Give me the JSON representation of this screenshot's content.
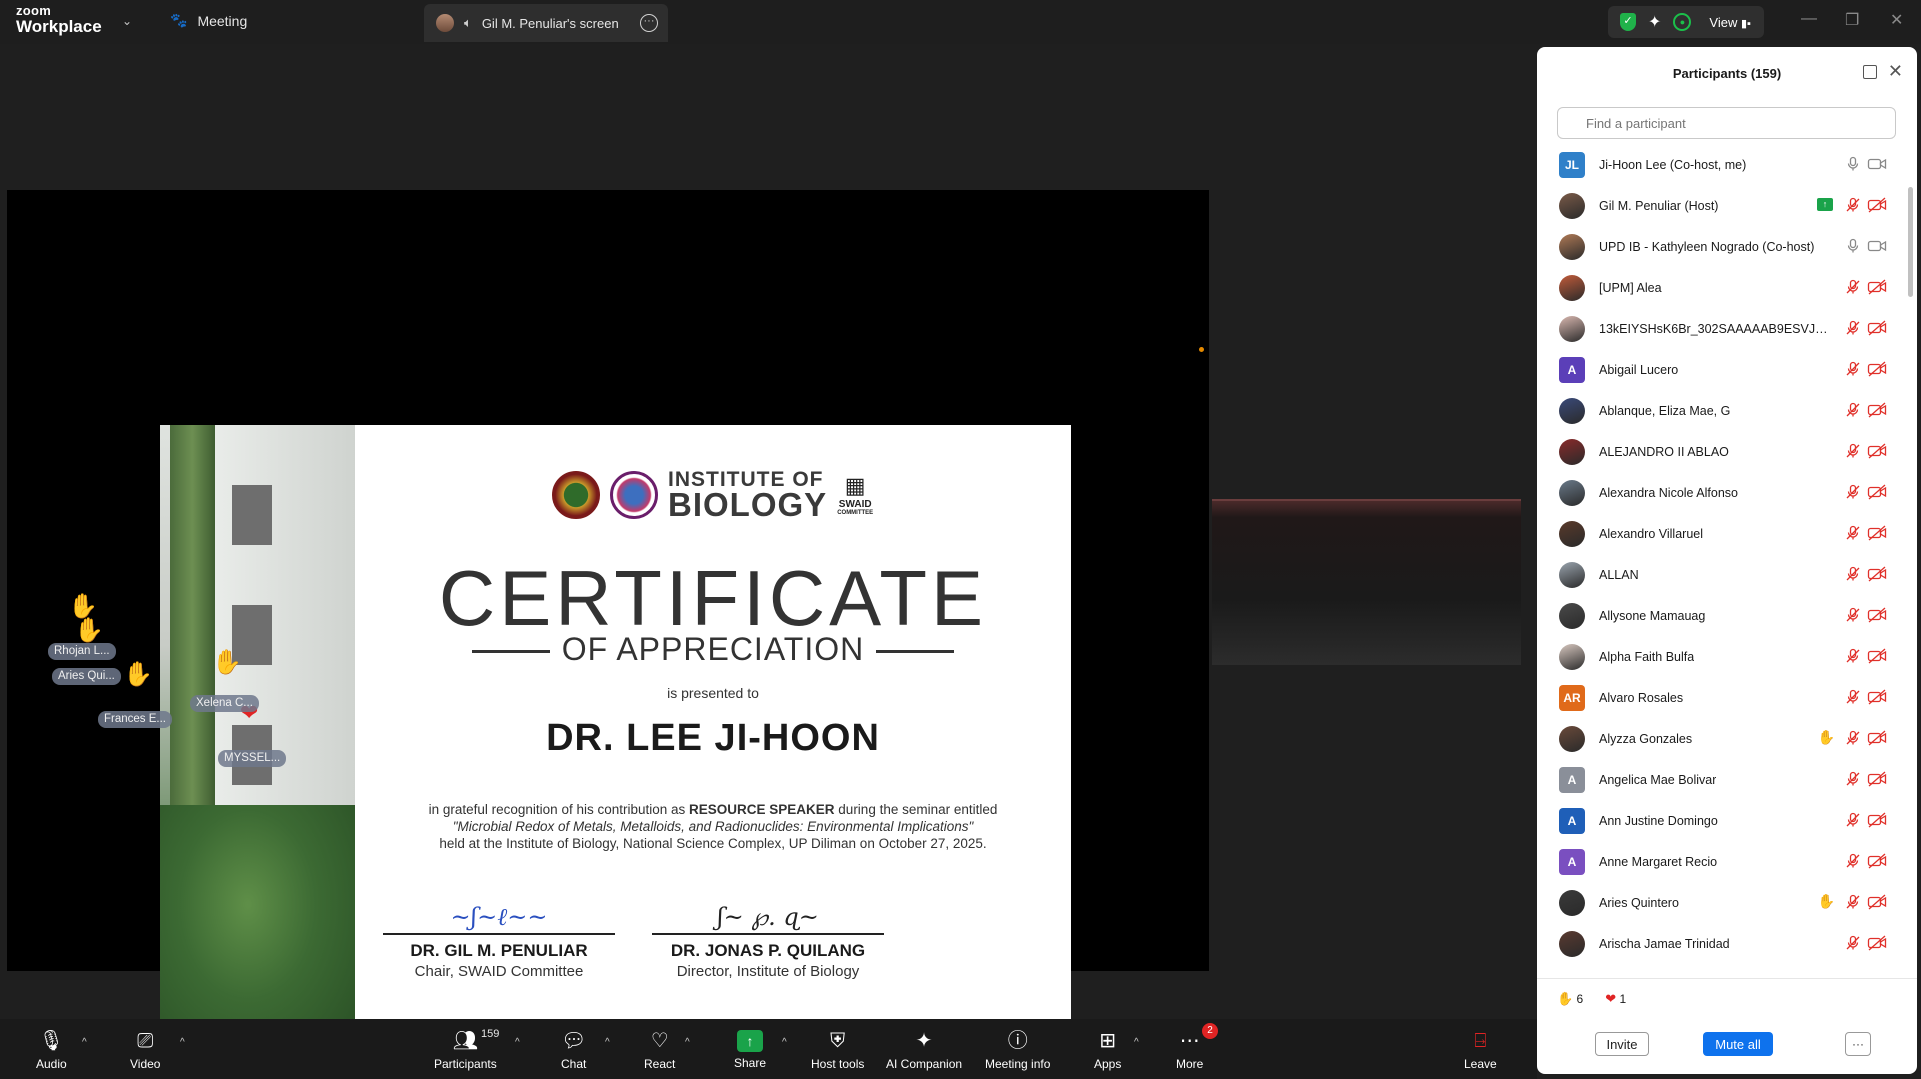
{
  "titlebar": {
    "logo_line1": "zoom",
    "logo_line2": "Workplace",
    "meeting_tab": "Meeting",
    "screen_tab": "Gil M. Penuliar's screen",
    "view_label": "View"
  },
  "certificate": {
    "institute_line1": "INSTITUTE OF",
    "institute_line2": "BIOLOGY",
    "swaid_label": "SWAID",
    "swaid_sub": "COMMITTEE",
    "title": "CERTIFICATE",
    "subtitle": "OF APPRECIATION",
    "presented_to": "is presented to",
    "recipient": "DR. LEE JI-HOON",
    "recog_pre": "in grateful recognition of his contribution as ",
    "recog_bold": "RESOURCE SPEAKER",
    "recog_post": " during the seminar entitled",
    "seminar_title": "\"Microbial Redox of Metals, Metalloids, and Radionuclides: Environmental Implications\"",
    "held_at": "held at the Institute of Biology, National Science Complex, UP Diliman on October 27, 2025.",
    "sig1_name": "DR. GIL M. PENULIAR",
    "sig1_role": "Chair, SWAID Committee",
    "sig2_name": "DR. JONAS P. QUILANG",
    "sig2_role": "Director, Institute of Biology"
  },
  "reactions_overlay": {
    "tags": [
      "Rhojan L...",
      "Aries Qui...",
      "Frances E...",
      "Xelena C...",
      "MYSSEL..."
    ]
  },
  "participants_panel": {
    "title": "Participants (159)",
    "search_placeholder": "Find a participant",
    "participants": [
      {
        "name": "Ji-Hoon Lee (Co-host, me)",
        "initials": "JL",
        "color": "#2f80c9",
        "photo": false,
        "mic": "on",
        "cam": "on",
        "share": false,
        "raise": false
      },
      {
        "name": "Gil M. Penuliar (Host)",
        "initials": "",
        "color": "#7a5a48",
        "photo": true,
        "mic": "muted",
        "cam": "off",
        "share": true,
        "raise": false
      },
      {
        "name": "UPD IB - Kathyleen Nogrado (Co-host)",
        "initials": "",
        "color": "#b07a56",
        "photo": true,
        "mic": "on",
        "cam": "on",
        "share": false,
        "raise": false
      },
      {
        "name": "[UPM] Alea",
        "initials": "",
        "color": "#c25b3a",
        "photo": true,
        "mic": "muted",
        "cam": "off",
        "share": false,
        "raise": false
      },
      {
        "name": "13kEIYSHsK6Br_302SAAAAAB9ESVJFQ1Q...",
        "initials": "",
        "color": "#d9b8b0",
        "photo": true,
        "mic": "muted",
        "cam": "off",
        "share": false,
        "raise": false
      },
      {
        "name": "Abigail Lucero",
        "initials": "A",
        "color": "#5b3fb8",
        "photo": false,
        "mic": "muted",
        "cam": "off",
        "share": false,
        "raise": false
      },
      {
        "name": "Ablanque, Eliza Mae, G",
        "initials": "",
        "color": "#3a4a7a",
        "photo": true,
        "mic": "muted",
        "cam": "off",
        "share": false,
        "raise": false
      },
      {
        "name": "ALEJANDRO II ABLAO",
        "initials": "",
        "color": "#8a2a2a",
        "photo": true,
        "mic": "muted",
        "cam": "off",
        "share": false,
        "raise": false
      },
      {
        "name": "Alexandra Nicole Alfonso",
        "initials": "",
        "color": "#6a7a8a",
        "photo": true,
        "mic": "muted",
        "cam": "off",
        "share": false,
        "raise": false
      },
      {
        "name": "Alexandro Villaruel",
        "initials": "",
        "color": "#5a3a2a",
        "photo": true,
        "mic": "muted",
        "cam": "off",
        "share": false,
        "raise": false
      },
      {
        "name": "ALLAN",
        "initials": "",
        "color": "#9aa4ae",
        "photo": true,
        "mic": "muted",
        "cam": "off",
        "share": false,
        "raise": false
      },
      {
        "name": "Allysone Mamauag",
        "initials": "",
        "color": "#4a4a4a",
        "photo": true,
        "mic": "muted",
        "cam": "off",
        "share": false,
        "raise": false
      },
      {
        "name": "Alpha Faith Bulfa",
        "initials": "",
        "color": "#d8c8c0",
        "photo": true,
        "mic": "muted",
        "cam": "off",
        "share": false,
        "raise": false
      },
      {
        "name": "Alvaro Rosales",
        "initials": "AR",
        "color": "#e06a1a",
        "photo": false,
        "mic": "muted",
        "cam": "off",
        "share": false,
        "raise": false
      },
      {
        "name": "Alyzza Gonzales",
        "initials": "",
        "color": "#6a4a3a",
        "photo": true,
        "mic": "muted",
        "cam": "off",
        "share": false,
        "raise": true
      },
      {
        "name": "Angelica Mae Bolivar",
        "initials": "A",
        "color": "#8a8f99",
        "photo": false,
        "mic": "muted",
        "cam": "off",
        "share": false,
        "raise": false
      },
      {
        "name": "Ann Justine Domingo",
        "initials": "A",
        "color": "#1f5fb8",
        "photo": false,
        "mic": "muted",
        "cam": "off",
        "share": false,
        "raise": false
      },
      {
        "name": "Anne Margaret Recio",
        "initials": "A",
        "color": "#7a4fc0",
        "photo": false,
        "mic": "muted",
        "cam": "off",
        "share": false,
        "raise": false
      },
      {
        "name": "Aries Quintero",
        "initials": "",
        "color": "#3a3a3a",
        "photo": true,
        "mic": "muted",
        "cam": "off",
        "share": false,
        "raise": true
      },
      {
        "name": "Arischa Jamae Trinidad",
        "initials": "",
        "color": "#5a3a30",
        "photo": true,
        "mic": "muted",
        "cam": "off",
        "share": false,
        "raise": false
      }
    ],
    "reaction_counts": {
      "clap": "6",
      "heart": "1"
    },
    "invite_label": "Invite",
    "mute_all_label": "Mute all",
    "more_label": "···"
  },
  "toolbar": {
    "audio": "Audio",
    "video": "Video",
    "participants": "Participants",
    "participants_count": "159",
    "chat": "Chat",
    "react": "React",
    "share": "Share",
    "host_tools": "Host tools",
    "ai_companion": "AI Companion",
    "meeting_info": "Meeting info",
    "apps": "Apps",
    "more": "More",
    "more_badge": "2",
    "leave": "Leave"
  }
}
